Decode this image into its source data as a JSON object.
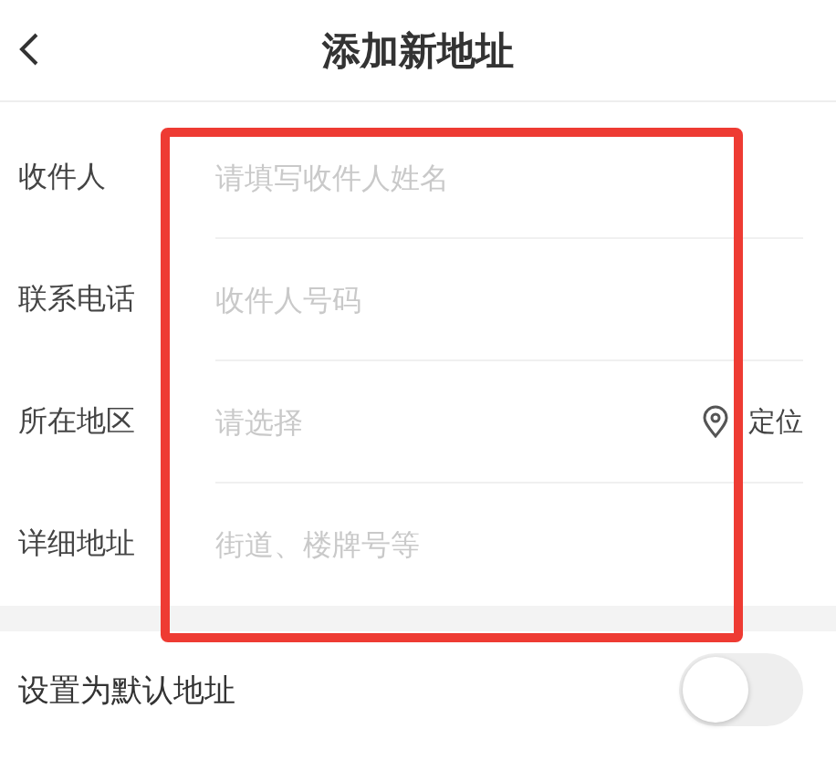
{
  "header": {
    "title": "添加新地址"
  },
  "fields": [
    {
      "kind": "text",
      "label": "收件人",
      "placeholder": "请填写收件人姓名"
    },
    {
      "kind": "text",
      "label": "联系电话",
      "placeholder": "收件人号码"
    },
    {
      "kind": "select",
      "label": "所在地区",
      "placeholder": "请选择",
      "action": "定位"
    },
    {
      "kind": "text",
      "label": "详细地址",
      "placeholder": "街道、楼牌号等"
    }
  ],
  "default_address": {
    "label": "设置为默认地址",
    "on": false
  },
  "annotation": {
    "kind": "rectangle"
  }
}
